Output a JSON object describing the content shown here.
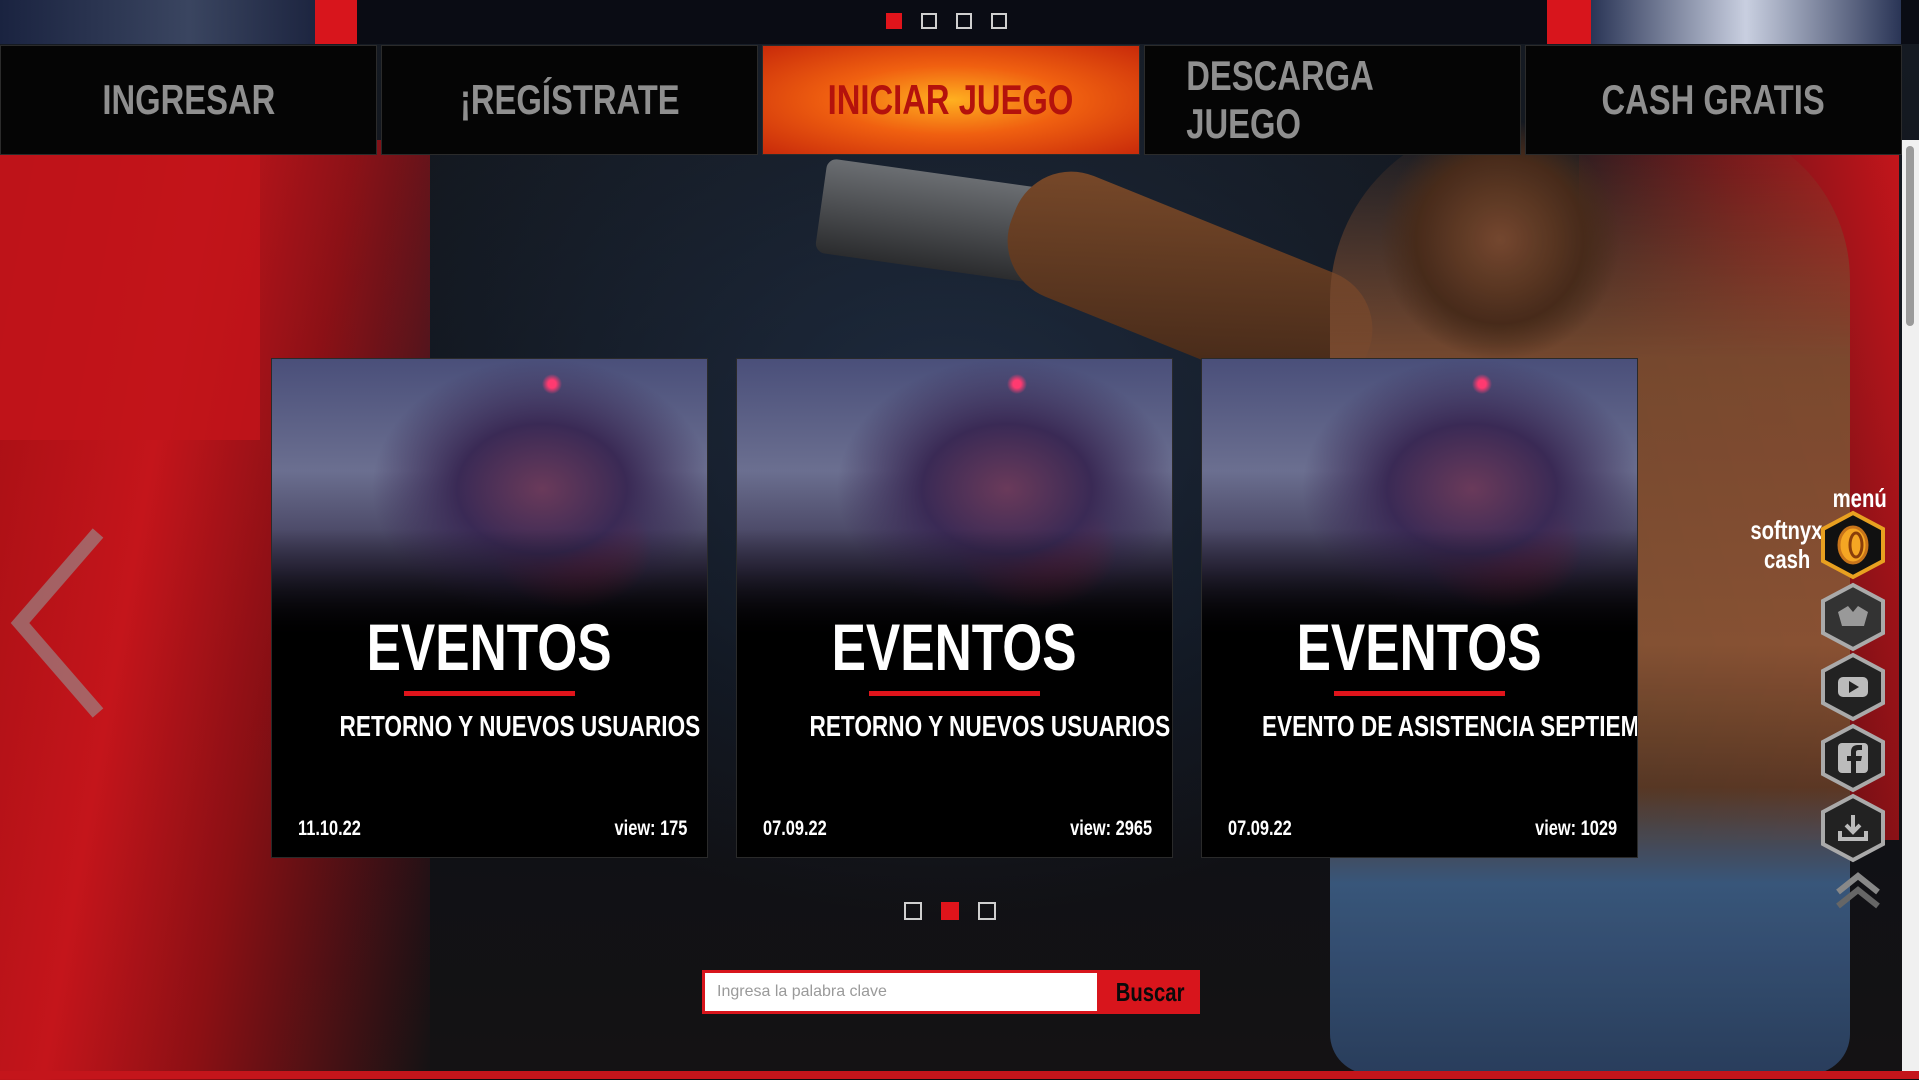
{
  "top_carousel": {
    "slides": 4,
    "active": 1
  },
  "nav": {
    "items": [
      {
        "label": "INGRESAR"
      },
      {
        "label": "¡REGÍSTRATE"
      },
      {
        "label": "INICIAR JUEGO"
      },
      {
        "label": "DESCARGA JUEGO"
      },
      {
        "label": "CASH GRATIS"
      }
    ]
  },
  "cards": [
    {
      "category": "EVENTOS",
      "title": "RETORNO Y NUEVOS USUARIOS OCTUBRE",
      "date": "11.10.22",
      "views": "view: 175"
    },
    {
      "category": "EVENTOS",
      "title": "RETORNO Y NUEVOS USUARIOS SEPTIEMBRE",
      "date": "07.09.22",
      "views": "view: 2965"
    },
    {
      "category": "EVENTOS",
      "title": "EVENTO DE ASISTENCIA SEPTIEMBRE",
      "date": "07.09.22",
      "views": "view: 1029"
    }
  ],
  "cards_carousel": {
    "slides": 3,
    "active": 2
  },
  "search": {
    "placeholder": "Ingresa la palabra clave",
    "button_label": "Buscar"
  },
  "side_menu": {
    "title": "menú",
    "cash_label_line1": "softnyx",
    "cash_label_line2": "cash",
    "icons": [
      "coin-icon",
      "wolf-logo-icon",
      "youtube-icon",
      "facebook-icon",
      "download-icon",
      "scroll-up-icon"
    ]
  },
  "colors": {
    "accent": "#e0141b",
    "nav_bg": "#050505",
    "nav_text": "#8f8f8f",
    "hot_text": "#b4120c"
  }
}
